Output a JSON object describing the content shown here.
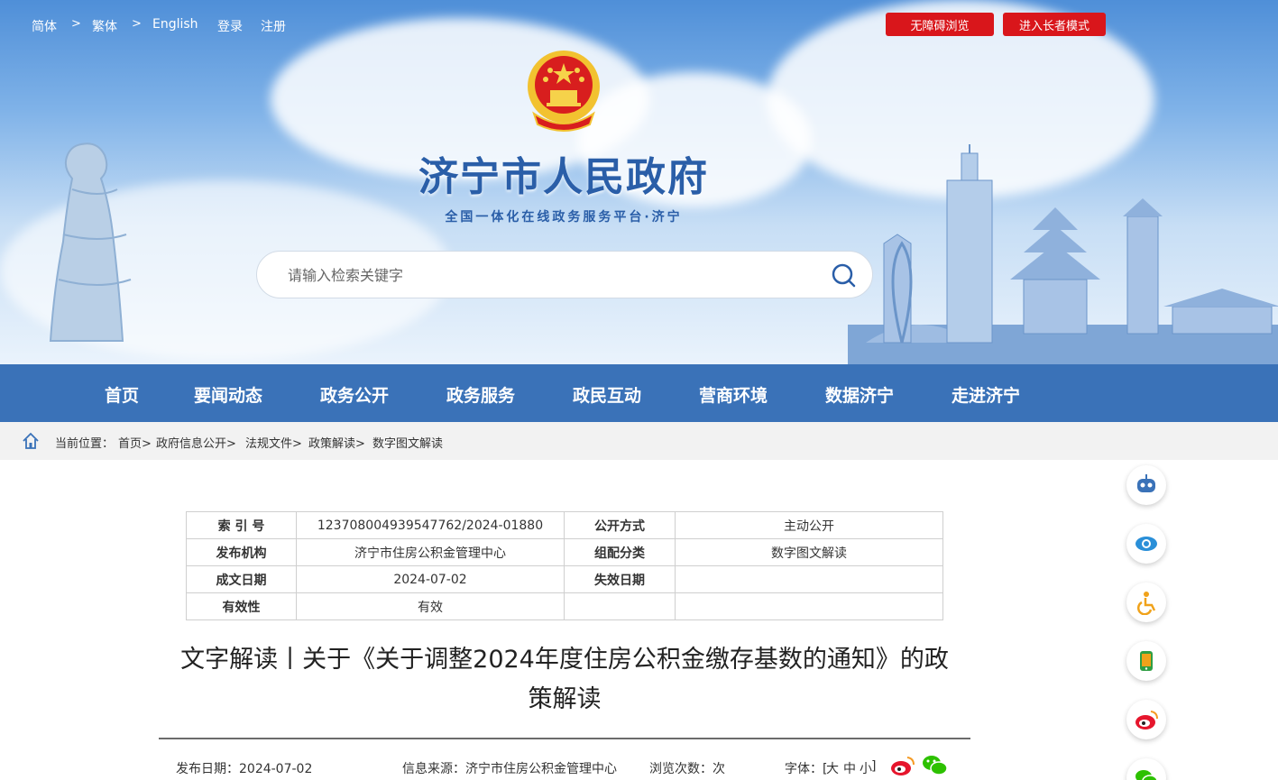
{
  "topbar": {
    "simplified": "简体",
    "traditional": "繁体",
    "english": "English",
    "login": "登录",
    "register": "注册",
    "sep": ">",
    "accessibility_btn": "无障碍浏览",
    "elder_btn": "进入长者模式"
  },
  "header": {
    "site_title": "济宁市人民政府",
    "site_subtitle": "全国一体化在线政务服务平台·济宁",
    "search_placeholder": "请输入检索关键字"
  },
  "nav": {
    "items": [
      "首页",
      "要闻动态",
      "政务公开",
      "政务服务",
      "政民互动",
      "营商环境",
      "数据济宁",
      "走进济宁"
    ]
  },
  "breadcrumb": {
    "prefix": "当前位置：",
    "items": [
      "首页>",
      "政府信息公开>",
      "法规文件>",
      "政策解读>",
      "数字图文解读"
    ]
  },
  "meta_table": {
    "rows": [
      {
        "k1": "索 引 号",
        "v1": "123708004939547762/2024-01880",
        "k2": "公开方式",
        "v2": "主动公开"
      },
      {
        "k1": "发布机构",
        "v1": "济宁市住房公积金管理中心",
        "k2": "组配分类",
        "v2": "数字图文解读"
      },
      {
        "k1": "成文日期",
        "v1": "2024-07-02",
        "k2": "失效日期",
        "v2": ""
      },
      {
        "k1": "有效性",
        "v1": "有效",
        "k2": "",
        "v2": ""
      }
    ]
  },
  "article": {
    "title_line1": "文字解读丨关于《关于调整2024年度住房公积金缴存基数的通知》的政",
    "title_line2": "策解读",
    "publish_date": "发布日期：2024-07-02",
    "source": "信息来源：济宁市住房公积金管理中心",
    "views": "浏览次数：次",
    "font_label": "字体：[",
    "font_large": "大",
    "font_medium": "中",
    "font_small": "小",
    "font_end": "]"
  },
  "colors": {
    "nav_bg": "#3a72b8",
    "title_blue": "#2a5ea8",
    "red_btn": "#d9161b",
    "crumb_bg": "#f2f2f2"
  }
}
